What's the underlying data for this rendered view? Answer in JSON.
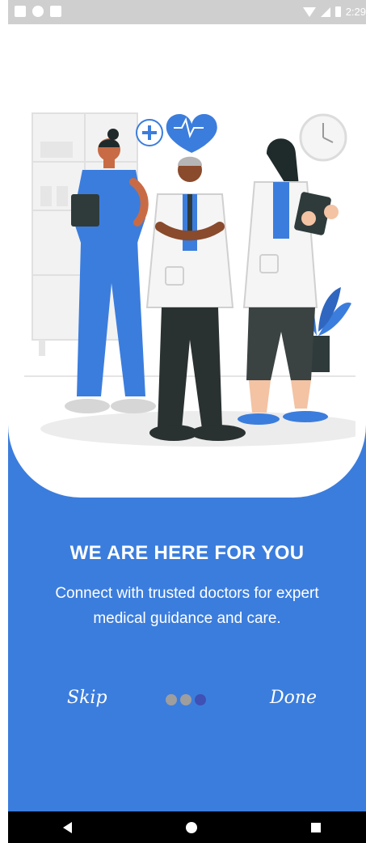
{
  "status_bar": {
    "time": "2:29",
    "left_icons": [
      "image-icon",
      "circle-status-icon",
      "sd-card-icon"
    ],
    "right_icons": [
      "wifi-icon",
      "signal-icon",
      "battery-icon"
    ]
  },
  "onboarding": {
    "title": "WE ARE HERE FOR YOU",
    "description": "Connect with trusted doctors for expert medical guidance and care.",
    "skip_label": "Skip",
    "done_label": "Done",
    "page_count": 3,
    "active_page": 3,
    "illustration": "doctors-team-illustration"
  },
  "nav_bar": {
    "icons": [
      "back-icon",
      "home-icon",
      "recents-icon"
    ]
  },
  "colors": {
    "primary": "#3b7ddd",
    "dot_inactive": "#9e9e9e",
    "dot_active": "#3f51b5",
    "white": "#ffffff"
  }
}
